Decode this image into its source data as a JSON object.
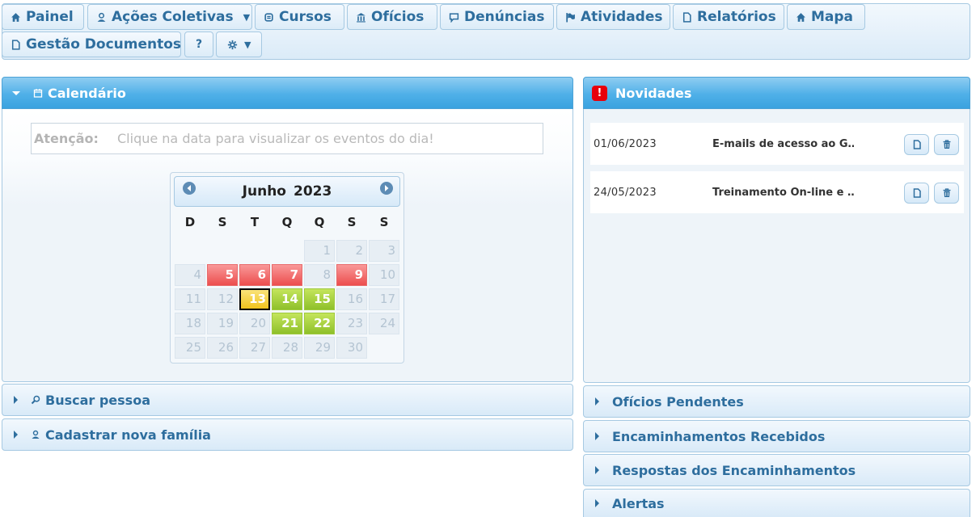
{
  "menu": {
    "painel": "Painel",
    "acoes_coletivas": "Ações Coletivas",
    "cursos": "Cursos",
    "oficios": "Ofícios",
    "denuncias": "Denúncias",
    "atividades": "Atividades",
    "relatorios": "Relatórios",
    "mapa": "Mapa",
    "gestao_documentos": "Gestão Documentos",
    "help": "?"
  },
  "calendar_panel": {
    "title": "Calendário",
    "attention_label": "Atenção:",
    "attention_text": "Clique na data para visualizar os eventos do dia!",
    "month": "Junho",
    "year": "2023",
    "weekdays": [
      "D",
      "S",
      "T",
      "Q",
      "Q",
      "S",
      "S"
    ],
    "colors": {
      "event_red": "#ec4d4d",
      "event_green": "#8fc02a",
      "today_yellow": "#f0c31d"
    },
    "days": [
      {
        "n": "1",
        "s": ""
      },
      {
        "n": "2",
        "s": ""
      },
      {
        "n": "3",
        "s": ""
      },
      {
        "n": "4",
        "s": ""
      },
      {
        "n": "5",
        "s": "red"
      },
      {
        "n": "6",
        "s": "red"
      },
      {
        "n": "7",
        "s": "red"
      },
      {
        "n": "8",
        "s": ""
      },
      {
        "n": "9",
        "s": "red"
      },
      {
        "n": "10",
        "s": ""
      },
      {
        "n": "11",
        "s": ""
      },
      {
        "n": "12",
        "s": ""
      },
      {
        "n": "13",
        "s": "yellow"
      },
      {
        "n": "14",
        "s": "green"
      },
      {
        "n": "15",
        "s": "green"
      },
      {
        "n": "16",
        "s": ""
      },
      {
        "n": "17",
        "s": ""
      },
      {
        "n": "18",
        "s": ""
      },
      {
        "n": "19",
        "s": ""
      },
      {
        "n": "20",
        "s": ""
      },
      {
        "n": "21",
        "s": "green"
      },
      {
        "n": "22",
        "s": "green"
      },
      {
        "n": "23",
        "s": ""
      },
      {
        "n": "24",
        "s": ""
      },
      {
        "n": "25",
        "s": ""
      },
      {
        "n": "26",
        "s": ""
      },
      {
        "n": "27",
        "s": ""
      },
      {
        "n": "28",
        "s": ""
      },
      {
        "n": "29",
        "s": ""
      },
      {
        "n": "30",
        "s": ""
      }
    ]
  },
  "left_sections": {
    "buscar_pessoa": "Buscar pessoa",
    "cadastrar_familia": "Cadastrar nova família"
  },
  "news_panel": {
    "title": "Novidades",
    "badge": "!",
    "items": [
      {
        "date": "01/06/2023",
        "title": "E-mails de acesso ao G…"
      },
      {
        "date": "24/05/2023",
        "title": "Treinamento On-line e …"
      }
    ]
  },
  "right_sections": {
    "oficios_pendentes": "Ofícios Pendentes",
    "encaminhamentos_recebidos": "Encaminhamentos Recebidos",
    "respostas_encaminhamentos": "Respostas dos Encaminhamentos",
    "alertas": "Alertas"
  }
}
